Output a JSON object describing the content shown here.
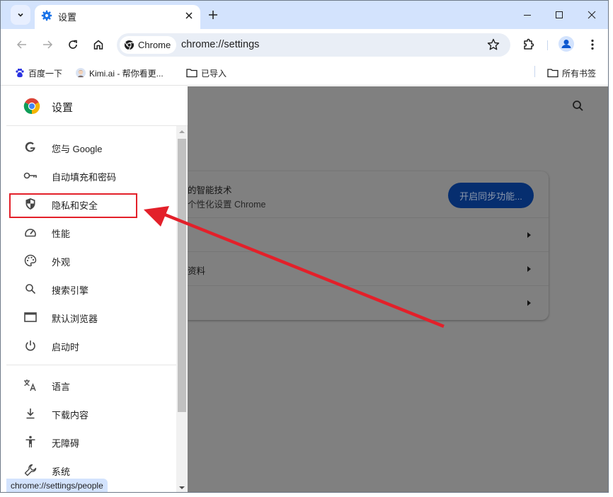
{
  "browser": {
    "tab": {
      "title": "设置",
      "icon": "gear-icon"
    },
    "new_tab_label": "+",
    "window_controls": [
      "minimize",
      "maximize",
      "close"
    ],
    "omnibox": {
      "chip_label": "Chrome",
      "url": "chrome://settings"
    },
    "bookmarks": [
      {
        "label": "百度一下",
        "icon": "baidu-paw-icon"
      },
      {
        "label": "Kimi.ai - 帮你看更...",
        "icon": "kimi-avatar-icon"
      },
      {
        "label": "已导入",
        "icon": "folder-icon"
      }
    ],
    "all_bookmarks_label": "所有书签",
    "status_url": "chrome://settings/people"
  },
  "settings": {
    "drawer_title": "设置",
    "nav_items": [
      {
        "label": "您与 Google",
        "icon": "google-g-icon"
      },
      {
        "label": "自动填充和密码",
        "icon": "key-icon"
      },
      {
        "label": "隐私和安全",
        "icon": "shield-icon"
      },
      {
        "label": "性能",
        "icon": "speedometer-icon"
      },
      {
        "label": "外观",
        "icon": "palette-icon"
      },
      {
        "label": "搜索引擎",
        "icon": "search-icon"
      },
      {
        "label": "默认浏览器",
        "icon": "browser-window-icon"
      },
      {
        "label": "启动时",
        "icon": "power-icon"
      },
      {
        "label": "语言",
        "icon": "translate-icon"
      },
      {
        "label": "下载内容",
        "icon": "download-icon"
      },
      {
        "label": "无障碍",
        "icon": "accessibility-icon"
      },
      {
        "label": "系统",
        "icon": "wrench-icon"
      }
    ],
    "main_card": {
      "line1": "的智能技术",
      "line2": "个性化设置 Chrome",
      "sync_button": "开启同步功能...",
      "row_labels": [
        "",
        "资料",
        ""
      ]
    }
  },
  "annotation": {
    "highlight_target": "隐私和安全",
    "color": "#e3202a"
  }
}
